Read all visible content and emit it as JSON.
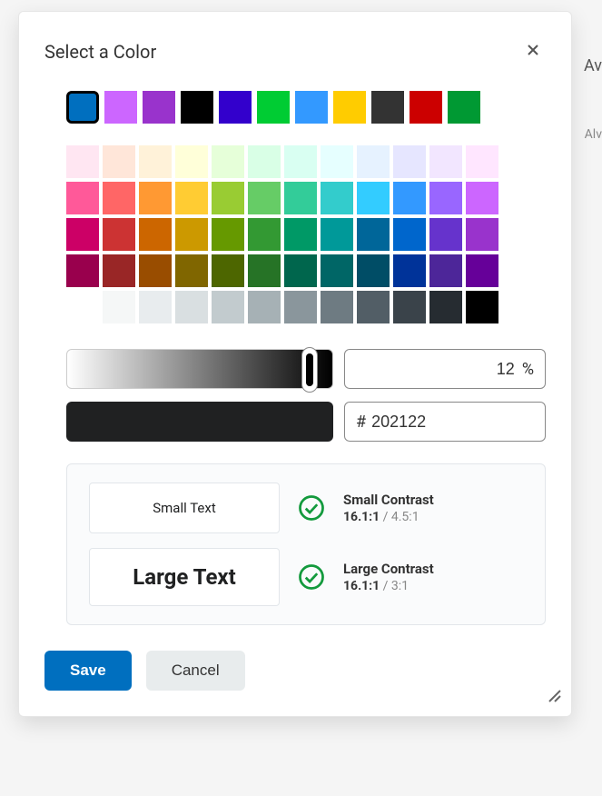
{
  "modal": {
    "title": "Select a Color",
    "preset_colors": [
      "#006fbf",
      "#cc66ff",
      "#9933cc",
      "#000000",
      "#3300cc",
      "#00cc33",
      "#3399ff",
      "#ffcc00",
      "#333333",
      "#cc0000",
      "#009933"
    ],
    "selected_preset_index": 0,
    "palette": [
      [
        "#ffe6f2",
        "#ffe6d9",
        "#fff2d9",
        "#ffffd9",
        "#e6ffd9",
        "#d9ffe6",
        "#d9fff2",
        "#e6ffff",
        "#e6f2ff",
        "#e6e6ff",
        "#f2e6ff",
        "#ffe6ff"
      ],
      [
        "#ff5999",
        "#ff6666",
        "#ff9933",
        "#ffcc33",
        "#99cc33",
        "#66cc66",
        "#33cc99",
        "#33cccc",
        "#33ccff",
        "#3399ff",
        "#9966ff",
        "#cc66ff"
      ],
      [
        "#cc0066",
        "#cc3333",
        "#cc6600",
        "#cc9900",
        "#669900",
        "#339933",
        "#009966",
        "#009999",
        "#006699",
        "#0066cc",
        "#6633cc",
        "#9933cc"
      ],
      [
        "#99004d",
        "#992626",
        "#994d00",
        "#806600",
        "#4d6600",
        "#267326",
        "#00664d",
        "#006666",
        "#004d66",
        "#003399",
        "#4d2699",
        "#660099"
      ],
      [
        "#ffffff",
        "#f5f7f7",
        "#e8ecee",
        "#d9dfe1",
        "#c2cbce",
        "#a6b1b5",
        "#8a969c",
        "#6e7b82",
        "#525e66",
        "#3a434a",
        "#262c31",
        "#000000"
      ]
    ],
    "brightness_value": "12",
    "brightness_symbol": "%",
    "hex_prefix": "#",
    "hex_value": "202122",
    "preview_color": "#202122",
    "contrast": {
      "small_sample": "Small Text",
      "large_sample": "Large Text",
      "small_label": "Small Contrast",
      "small_ratio": "16.1:1",
      "small_req": "/ 4.5:1",
      "large_label": "Large Contrast",
      "large_ratio": "16.1:1",
      "large_req": "/ 3:1"
    },
    "save_label": "Save",
    "cancel_label": "Cancel"
  },
  "background": {
    "text_top": "Av",
    "text_mid": "Alv"
  }
}
